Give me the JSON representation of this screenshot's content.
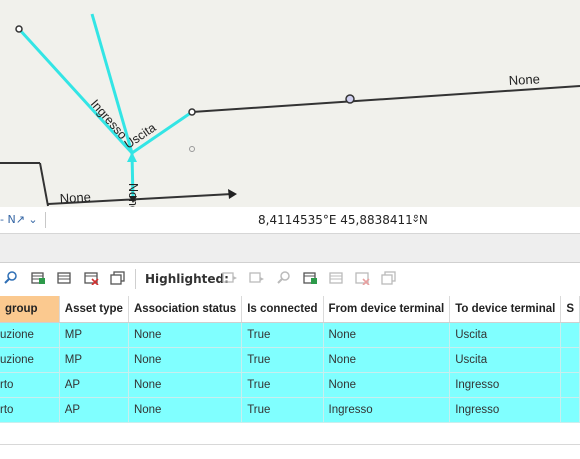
{
  "map": {
    "labels": {
      "none_top": "None",
      "ingresso": "Ingresso",
      "uscita": "Uscita",
      "none_bottom": "None",
      "none_vertical": "None"
    },
    "colors": {
      "background": "#f1f1ec",
      "selection": "#33e5e5",
      "line": "#333333"
    }
  },
  "statusbar": {
    "scale_icon": "north-arrow-icon",
    "coordinates": "8,4114535°E 45,8838411°N"
  },
  "toolbar": {
    "highlighted_label": "Highlighted:"
  },
  "table": {
    "columns": [
      {
        "label": "group",
        "sorted": true
      },
      {
        "label": "Asset type",
        "sorted": false
      },
      {
        "label": "Association status",
        "sorted": false
      },
      {
        "label": "Is connected",
        "sorted": false
      },
      {
        "label": "From device terminal",
        "sorted": false
      },
      {
        "label": "To device terminal",
        "sorted": false
      },
      {
        "label": "S",
        "sorted": false
      }
    ],
    "rows": [
      [
        "uzione",
        "MP",
        "None",
        "True",
        "None",
        "Uscita",
        ""
      ],
      [
        "uzione",
        "MP",
        "None",
        "True",
        "None",
        "Uscita",
        ""
      ],
      [
        "rto",
        "AP",
        "None",
        "True",
        "None",
        "Ingresso",
        ""
      ],
      [
        "rto",
        "AP",
        "None",
        "True",
        "Ingresso",
        "Ingresso",
        ""
      ]
    ],
    "highlight_color": "#80ffff",
    "sorted_header_color": "#fbc98f"
  }
}
